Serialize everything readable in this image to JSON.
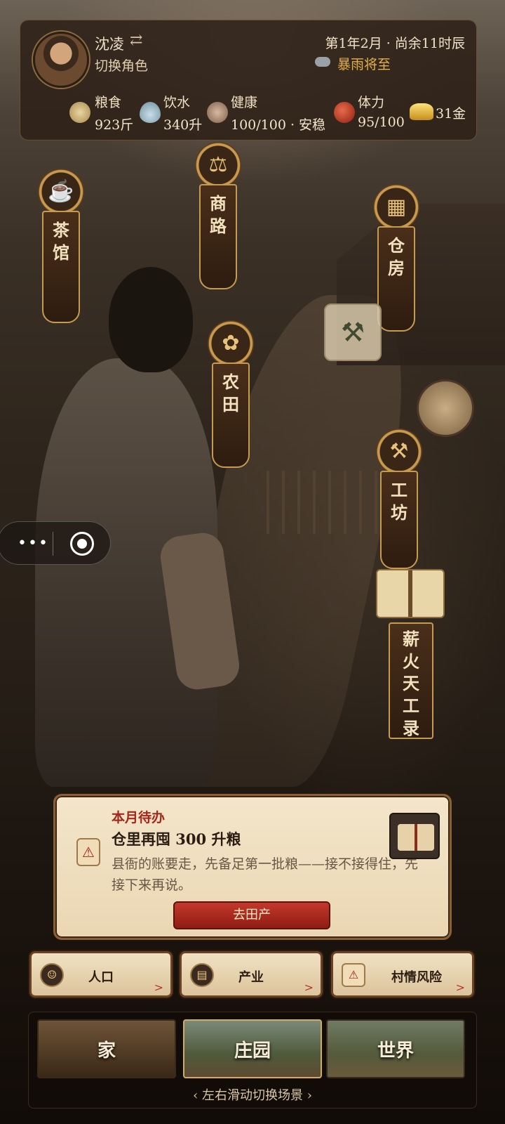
{
  "header": {
    "character_name": "沈凌",
    "swap_icon": "⇄",
    "switch_role_label": "切换角色",
    "date": "第1年2月 · 尚余11时辰",
    "weather": "暴雨将至"
  },
  "resources": {
    "grain": {
      "label": "粮食",
      "value": "923斤"
    },
    "water": {
      "label": "饮水",
      "value": "340升"
    },
    "health": {
      "label": "健康",
      "value": "100/100 · 安稳"
    },
    "stamina": {
      "label": "体力",
      "value": "95/100"
    },
    "gold": {
      "value": "31金"
    }
  },
  "map": {
    "teahouse": {
      "icon": "teapot-icon",
      "chars": [
        "茶",
        "馆"
      ]
    },
    "trade_route": {
      "icon": "scales-icon",
      "chars": [
        "商",
        "路"
      ]
    },
    "warehouse": {
      "icon": "crates-icon",
      "chars": [
        "仓",
        "房"
      ]
    },
    "farmland": {
      "icon": "sprout-icon",
      "chars": [
        "农",
        "田"
      ]
    },
    "workshop": {
      "icon": "anvil-icon",
      "chars": [
        "工",
        "坊"
      ]
    },
    "records": {
      "icon": "book-icon",
      "chars": [
        "薪",
        "火",
        "天",
        "工",
        "录"
      ]
    }
  },
  "todo": {
    "title": "本月待办",
    "heading": "仓里再囤 300 升粮",
    "body": "县衙的账要走，先备足第一批粮——接不接得住，先接下来再说。",
    "button": "去田产"
  },
  "quick_actions": [
    {
      "label": "人口",
      "icon": "people-icon"
    },
    {
      "label": "产业",
      "icon": "ledger-icon"
    },
    {
      "label": "村情风险",
      "icon": "warning-icon"
    }
  ],
  "scenes": {
    "tabs": [
      "家",
      "庄园",
      "世界"
    ],
    "active": "庄园",
    "hint": "左右滑动切换场景"
  },
  "colors": {
    "accent_gold": "#d2ad5e",
    "alert_red": "#a6261b",
    "weather_amber": "#e3b04a"
  }
}
